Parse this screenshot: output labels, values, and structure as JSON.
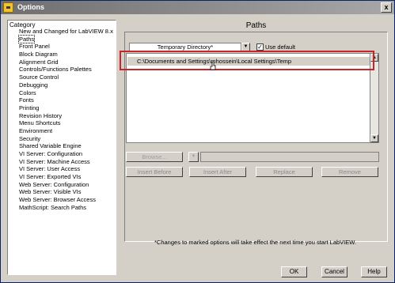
{
  "window": {
    "title": "Options",
    "close_glyph": "x"
  },
  "category": {
    "header": "Category",
    "items": [
      "New and Changed for LabVIEW 8.x",
      "Paths",
      "Front Panel",
      "Block Diagram",
      "Alignment Grid",
      "Controls/Functions Palettes",
      "Source Control",
      "Debugging",
      "Colors",
      "Fonts",
      "Printing",
      "Revision History",
      "Menu Shortcuts",
      "Environment",
      "Security",
      "Shared Variable Engine",
      "VI Server: Configuration",
      "VI Server: Machine Access",
      "VI Server: User Access",
      "VI Server: Exported VIs",
      "Web Server: Configuration",
      "Web Server: Visible VIs",
      "Web Server: Browser Access",
      "MathScript: Search Paths"
    ],
    "selected": "Paths"
  },
  "paths": {
    "title": "Paths",
    "dropdown_value": "Temporary Directory*",
    "use_default_label": "Use default",
    "use_default_checked": true,
    "path_entries": [
      "C:\\Documents and Settings\\mhossein\\Local Settings\\Temp"
    ],
    "browse_label": "Browse...",
    "insert_before_label": "Insert Before",
    "insert_after_label": "Insert After",
    "replace_label": "Replace",
    "remove_label": "Remove"
  },
  "footnote": "*Changes to marked options will take effect the next time you start LabVIEW.",
  "buttons": {
    "ok": "OK",
    "cancel": "Cancel",
    "help": "Help"
  },
  "colors": {
    "highlight": "#c8242a",
    "titlebar": "#6f6f6f",
    "face": "#d4d0c8"
  }
}
